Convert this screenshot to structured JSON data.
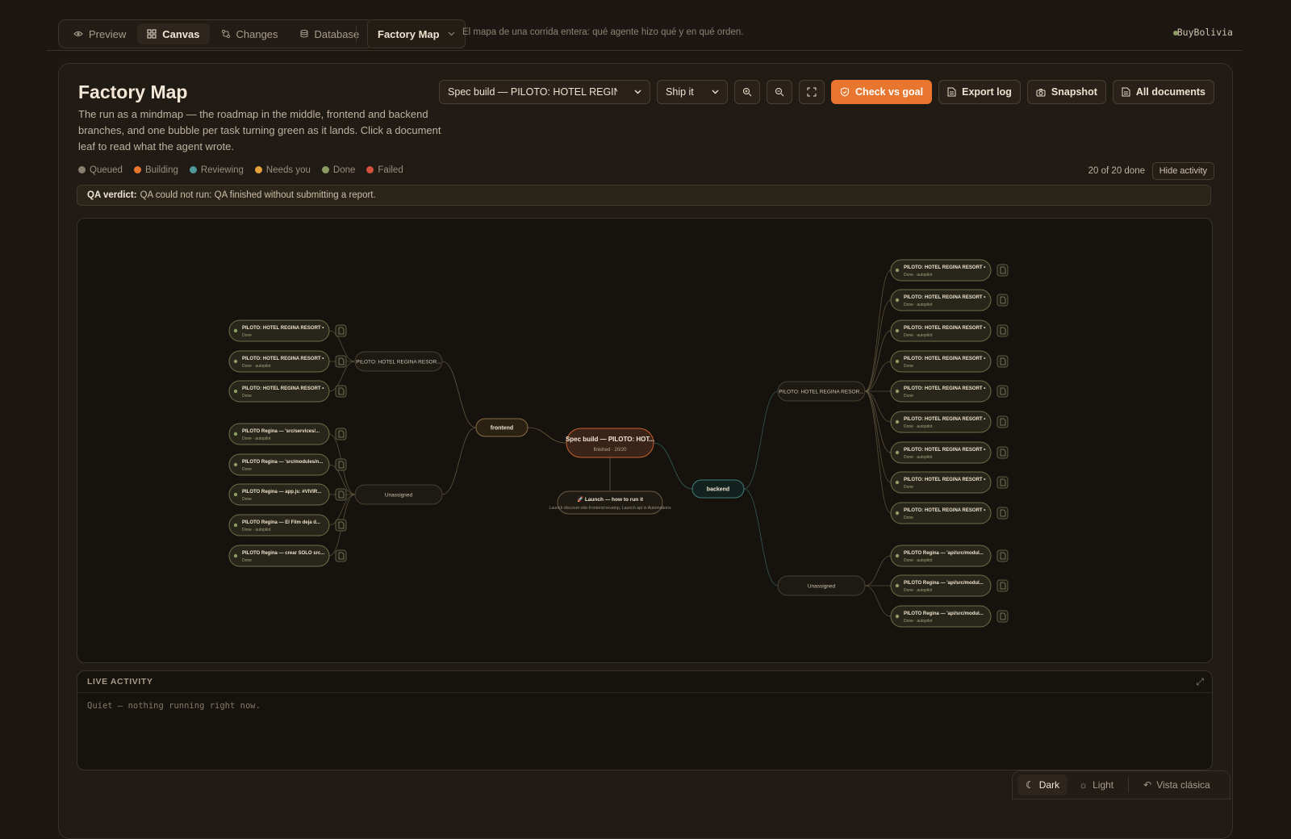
{
  "topbar": {
    "tabs": [
      {
        "label": "Preview",
        "icon": "eye-icon",
        "active": false
      },
      {
        "label": "Canvas",
        "icon": "grid-icon",
        "active": true
      },
      {
        "label": "Changes",
        "icon": "git-compare-icon",
        "active": false
      },
      {
        "label": "Database",
        "icon": "database-icon",
        "active": false
      }
    ],
    "view_dropdown": "Factory Map",
    "subtitle": "El mapa de una corrida entera: qué agente hizo qué y en qué orden.",
    "user": "BuyBolivia"
  },
  "page": {
    "title": "Factory Map",
    "description": "The run as a mindmap — the roadmap in the middle, frontend and backend branches, and one bubble per task turning green as it lands. Click a document leaf to read what the agent wrote.",
    "run_select": "Spec build — PILOTO: HOTEL REGINA RESORT",
    "mode_select": "Ship it",
    "buttons": {
      "check": "Check vs goal",
      "export": "Export log",
      "snapshot": "Snapshot",
      "documents": "All documents"
    },
    "legend": [
      {
        "label": "Queued",
        "color": "#8a8070"
      },
      {
        "label": "Building",
        "color": "#e8762f"
      },
      {
        "label": "Reviewing",
        "color": "#4d9a99"
      },
      {
        "label": "Needs you",
        "color": "#e3a23c"
      },
      {
        "label": "Done",
        "color": "#8c9a63"
      },
      {
        "label": "Failed",
        "color": "#d2513d"
      }
    ],
    "done_count": "20 of 20 done",
    "hide_activity": "Hide activity",
    "qa_label": "QA verdict:",
    "qa_text": "QA could not run: QA finished without submitting a report."
  },
  "map": {
    "root": {
      "label": "Spec build — PILOTO: HOT...",
      "sub": "finished · 20/20"
    },
    "launch": {
      "label": "🚀 Launch — how to run it",
      "sub": "Launch discover-site-frontend-revamp, Launch api in Automations"
    },
    "frontend": {
      "label": "frontend"
    },
    "backend": {
      "label": "backend"
    },
    "groups": {
      "fe_regina": "PILOTO: HOTEL REGINA RESOR...",
      "fe_unassigned": "Unassigned",
      "be_regina": "PILOTO: HOTEL REGINA RESOR...",
      "be_unassigned": "Unassigned"
    },
    "fe_regina_tasks": [
      {
        "title": "PILOTO: HOTEL REGINA RESORT •",
        "status": "Done"
      },
      {
        "title": "PILOTO: HOTEL REGINA RESORT •",
        "status": "Done · autopilot"
      },
      {
        "title": "PILOTO: HOTEL REGINA RESORT •",
        "status": "Done"
      }
    ],
    "fe_unassigned_tasks": [
      {
        "title": "PILOTO Regina — 'src/services/...",
        "status": "Done · autopilot"
      },
      {
        "title": "PILOTO Regina — 'src/modules/n...",
        "status": "Done"
      },
      {
        "title": "PILOTO Regina — app.js: #VIVIR...",
        "status": "Done"
      },
      {
        "title": "PILOTO Regina — El Film deja d...",
        "status": "Done · autopilot"
      },
      {
        "title": "PILOTO Regina — crear SOLO src...",
        "status": "Done"
      }
    ],
    "be_regina_tasks": [
      {
        "title": "PILOTO: HOTEL REGINA RESORT •",
        "status": "Done · autopilot"
      },
      {
        "title": "PILOTO: HOTEL REGINA RESORT •",
        "status": "Done · autopilot"
      },
      {
        "title": "PILOTO: HOTEL REGINA RESORT •",
        "status": "Done · autopilot"
      },
      {
        "title": "PILOTO: HOTEL REGINA RESORT •",
        "status": "Done"
      },
      {
        "title": "PILOTO: HOTEL REGINA RESORT •",
        "status": "Done"
      },
      {
        "title": "PILOTO: HOTEL REGINA RESORT •",
        "status": "Done · autopilot"
      },
      {
        "title": "PILOTO: HOTEL REGINA RESORT •",
        "status": "Done · autopilot"
      },
      {
        "title": "PILOTO: HOTEL REGINA RESORT •",
        "status": "Done"
      },
      {
        "title": "PILOTO: HOTEL REGINA RESORT •",
        "status": "Done"
      }
    ],
    "be_unassigned_tasks": [
      {
        "title": "PILOTO Regina — 'api/src/modul...",
        "status": "Done · autopilot"
      },
      {
        "title": "PILOTO Regina — 'api/src/modul...",
        "status": "Done · autopilot"
      },
      {
        "title": "PILOTO Regina — 'api/src/modul...",
        "status": "Done · autopilot"
      }
    ]
  },
  "activity": {
    "title": "LIVE ACTIVITY",
    "empty": "Quiet — nothing running right now."
  },
  "theme": {
    "dark": "Dark",
    "light": "Light",
    "classic": "Vista clásica"
  }
}
